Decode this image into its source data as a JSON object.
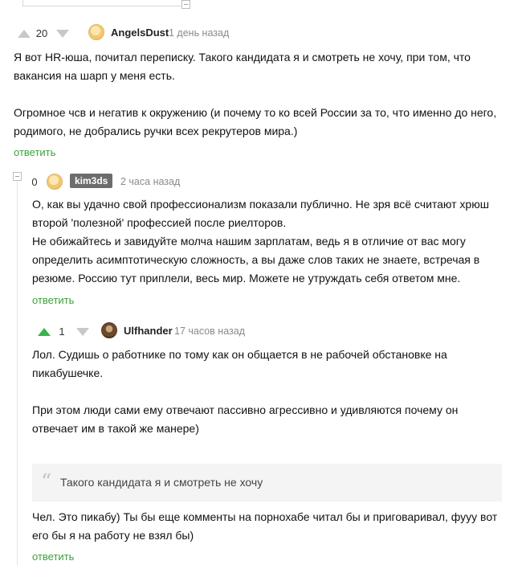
{
  "comments": [
    {
      "rating": "20",
      "username": "AngelsDust",
      "time": "1 день назад",
      "body": [
        "Я вот HR-юша, почитал переписку. Такого кандидата я и смотреть не хочу, при том, что",
        "вакансия на шарп у меня есть.",
        "",
        "Огромное чсв и негатив к окружению (и почему то ко всей России за то, что именно до него,",
        "родимого, не добрались ручки всех рекрутеров мира.)"
      ],
      "reply_label": "ответить"
    },
    {
      "rating": "0",
      "username": "kim3ds",
      "time": "2 часа назад",
      "body": [
        "О, как вы удачно свой профессионализм показали публично. Не зря всё считают хрюш",
        "второй 'полезной' профессией после риелторов.",
        "Не обижайтесь и завидуйте молча нашим зарплатам, ведь я в отличие от вас могу",
        "определить асимптотическую сложность, а вы даже слов таких не знаете, встречая в",
        "резюме. Россию тут приплели, весь мир. Можете не утруждать себя ответом мне."
      ],
      "reply_label": "ответить"
    },
    {
      "rating": "1",
      "username": "Ulfhander",
      "time": "17 часов назад",
      "body": [
        "Лол. Судишь о работнике по тому как он общается в не рабочей обстановке на",
        "пикабушечке.",
        "",
        "При этом люди сами ему отвечают пассивно агрессивно и удивляются почему он",
        "отвечает им в такой же манере)"
      ],
      "quote_mark": "“",
      "quote": "Такого кандидата я и смотреть не хочу",
      "body_after": [
        "Чел. Это пикабу) Ты бы еще комменты на порнохабе читал бы и приговаривал, фууу вот",
        "его бы я на работу не взял бы)"
      ],
      "reply_label": "ответить"
    }
  ],
  "colors": {
    "accent_green": "#3bb34a",
    "reply_green": "#3aa33a",
    "badge": "#6c6c6c"
  }
}
